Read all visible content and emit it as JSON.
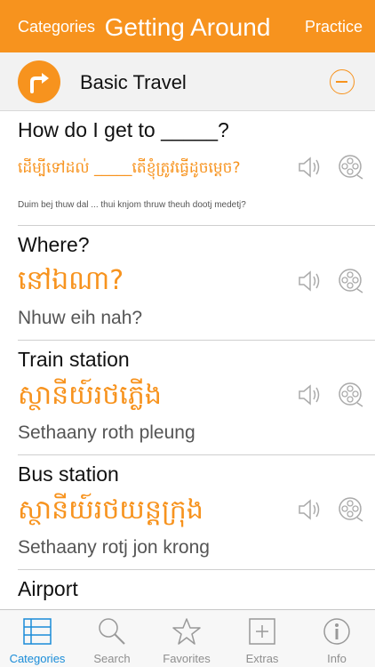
{
  "nav": {
    "left_label": "Categories",
    "title": "Getting Around",
    "right_label": "Practice"
  },
  "section": {
    "name": "Basic Travel"
  },
  "phrases": [
    {
      "english": "How do I get to _____?",
      "khmer": "ដើម្បីទៅដល់ _____តើខ្ញុំត្រូវធ្វើដូចម្តេច?",
      "phonetic": "Duim bej thuw dal ... thui knjom thruw theuh dootj medetj?"
    },
    {
      "english": "Where?",
      "khmer": "នៅឯណា?",
      "phonetic": "Nhuw eih nah?"
    },
    {
      "english": "Train station",
      "khmer": "ស្ថានីយ៍រថភ្លើង",
      "phonetic": "Sethaany roth pleung"
    },
    {
      "english": "Bus station",
      "khmer": "ស្ថានីយ៍រថយន្តក្រុង",
      "phonetic": "Sethaany rotj jon krong"
    },
    {
      "english": "Airport"
    }
  ],
  "tabbar": {
    "items": [
      {
        "label": "Categories",
        "icon": "list-icon",
        "active": true
      },
      {
        "label": "Search",
        "icon": "search-icon",
        "active": false
      },
      {
        "label": "Favorites",
        "icon": "star-icon",
        "active": false
      },
      {
        "label": "Extras",
        "icon": "plus-box-icon",
        "active": false
      },
      {
        "label": "Info",
        "icon": "info-icon",
        "active": false
      }
    ]
  },
  "colors": {
    "accent": "#f7931e",
    "tab_active": "#1a8cd8",
    "tab_inactive": "#8e8e8e"
  }
}
